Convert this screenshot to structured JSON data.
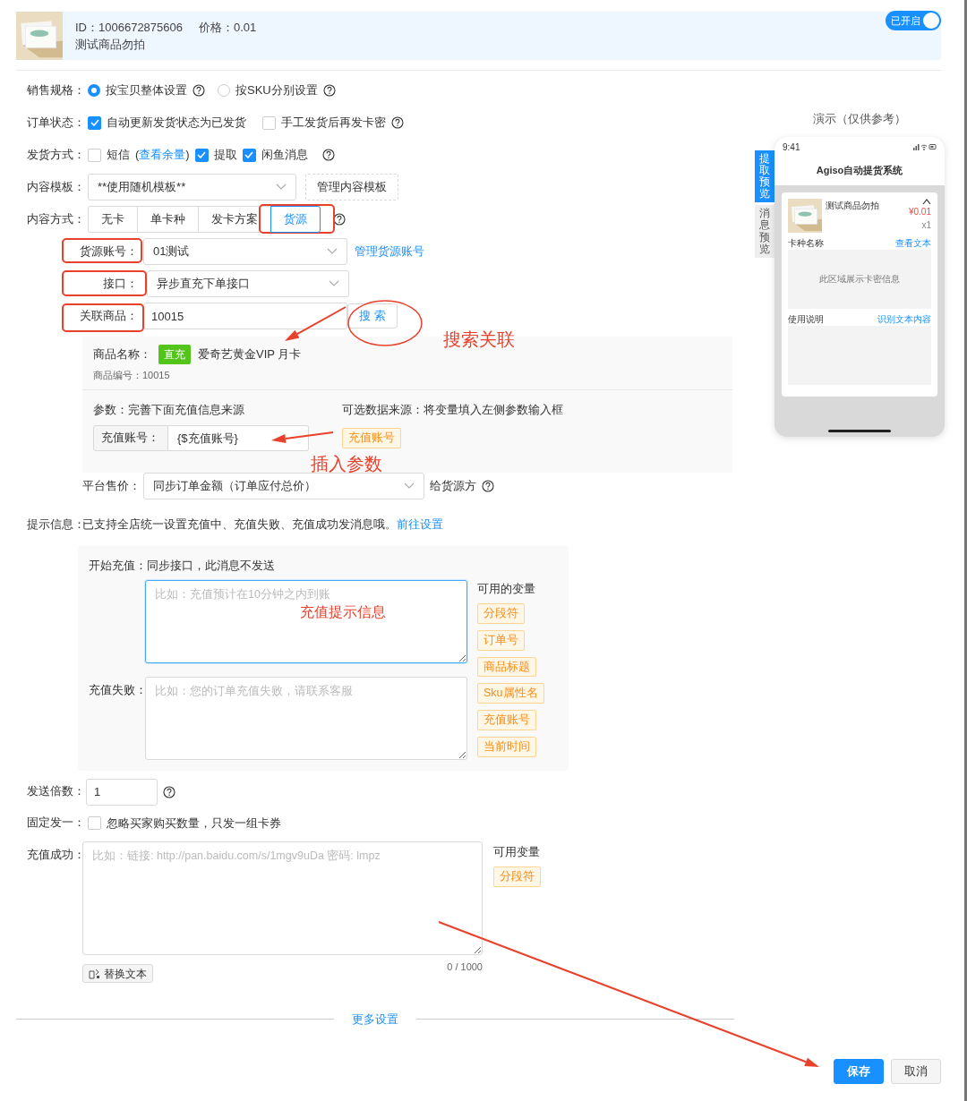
{
  "product": {
    "id": "ID：1006672875606",
    "price": "价格：0.01",
    "title": "测试商品勿拍"
  },
  "toggle": {
    "label": "已开启",
    "on": true
  },
  "sales_spec": {
    "label": "销售规格：",
    "options": [
      {
        "label": "按宝贝整体设置",
        "selected": true
      },
      {
        "label": "按SKU分别设置",
        "selected": false
      }
    ]
  },
  "order_status": {
    "label": "订单状态：",
    "options": [
      {
        "label": "自动更新发货状态为已发货",
        "checked": true
      },
      {
        "label": "手工发货后再发卡密",
        "checked": false
      }
    ]
  },
  "delivery": {
    "label": "发货方式：",
    "options": [
      {
        "label": "短信",
        "checked": false,
        "link_before": "(",
        "link": "查看余量",
        "link_after": ")"
      },
      {
        "label": "提取",
        "checked": true
      },
      {
        "label": "闲鱼消息",
        "checked": true
      }
    ]
  },
  "content_template": {
    "label": "内容模板：",
    "value": "**使用随机模板**",
    "button": "管理内容模板"
  },
  "content_mode": {
    "label": "内容方式：",
    "tabs": [
      {
        "label": "无卡",
        "selected": false
      },
      {
        "label": "单卡种",
        "selected": false
      },
      {
        "label": "发卡方案",
        "selected": false
      },
      {
        "label": "货源",
        "selected": true
      }
    ]
  },
  "source_account": {
    "label": "货源账号：",
    "value": "01测试",
    "link": "管理货源账号"
  },
  "interface": {
    "label": "接口：",
    "value": "异步直充下单接口"
  },
  "linked_product": {
    "label": "关联商品：",
    "value": "10015",
    "button": "搜 索"
  },
  "product_info": {
    "name_label": "商品名称：",
    "tag": "直充",
    "name": "爱奇艺黄金VIP 月卡",
    "code": "商品编号：10015",
    "params_title": "参数：完善下面充值信息来源",
    "sources_title": "可选数据来源：将变量填入左侧参数输入框",
    "param": {
      "label": "充值账号：",
      "value": "{$充值账号}"
    },
    "source_tags": [
      "充值账号"
    ]
  },
  "platform_price": {
    "label": "平台售价：",
    "value": "同步订单金额（订单应付总价）",
    "suffix": "给货源方"
  },
  "tip": {
    "label": "提示信息：",
    "text": "已支持全店统一设置充值中、充值失败、充值成功发消息哦。",
    "link": "前往设置"
  },
  "messages": {
    "start": {
      "label": "开始充值：",
      "note": "同步接口，此消息不发送",
      "placeholder": "比如：充值预计在10分钟之内到账",
      "focused": true
    },
    "fail": {
      "label": "充值失败：",
      "placeholder": "比如：您的订单充值失败，请联系客服",
      "focused": false
    },
    "vars_title": "可用的变量",
    "vars": [
      "分段符",
      "订单号",
      "商品标题",
      "Sku属性名",
      "充值账号",
      "当前时间"
    ]
  },
  "send_multiple": {
    "label": "发送倍数：",
    "value": "1"
  },
  "fixed_one": {
    "label": "固定发一：",
    "text": "忽略买家购买数量，只发一组卡券",
    "checked": false
  },
  "success": {
    "label": "充值成功：",
    "placeholder": "比如：链接: http://pan.baidu.com/s/1mgv9uDa 密码: lmpz",
    "counter": "0 / 1000",
    "replace_button": "替换文本",
    "vars_title": "可用变量",
    "vars": [
      "分段符"
    ]
  },
  "more_settings": "更多设置",
  "actions": [
    {
      "label": "保存",
      "kind": "primary"
    },
    {
      "label": "取消",
      "kind": "secondary"
    }
  ],
  "preview": {
    "title": "演示（仅供参考）",
    "tabs": [
      {
        "label": "提取预览",
        "selected": true
      },
      {
        "label": "消息预览",
        "selected": false
      }
    ],
    "phone": {
      "time": "9:41",
      "app_title": "Agiso自动提货系统",
      "product": "测试商品勿拍",
      "price": "¥0.01",
      "qty": "x1",
      "card_label": "卡种名称",
      "card_link": "查看文本",
      "card_placeholder": "此区域展示卡密信息",
      "usage_label": "使用说明",
      "usage_link": "识别文本内容"
    }
  },
  "annotations": [
    {
      "text": "搜索关联"
    },
    {
      "text": "插入参数"
    },
    {
      "text": "充值提示信息"
    }
  ]
}
